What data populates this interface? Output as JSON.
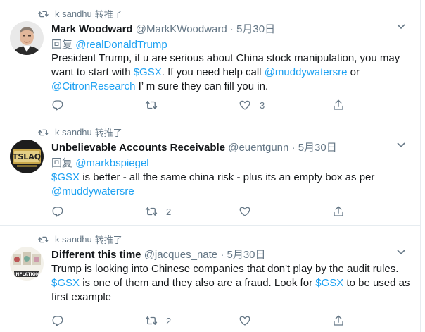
{
  "tweets": [
    {
      "retweeted_by": "k sandhu",
      "retweet_label": "转推了",
      "name": "Mark Woodward",
      "handle": "@MarkKWoodward",
      "dot": "·",
      "date": "5月30日",
      "reply_prefix": "回复",
      "reply_to": "@realDonaldTrump",
      "text": {
        "a": "President Trump, if u are serious about China stock manipulation, you may want to start with ",
        "link1": "$GSX",
        "b": ".  If you need help call ",
        "link2": "@muddywatersre",
        "c": "  or ",
        "link3": "@CitronResearch",
        "d": "   I’   m sure they can fill you in."
      },
      "actions": {
        "reply": "",
        "retweet": "",
        "like": "3"
      }
    },
    {
      "retweeted_by": "k sandhu",
      "retweet_label": "转推了",
      "name": "Unbelievable Accounts Receivable",
      "handle": "@euentgunn",
      "dot": "·",
      "date": "5月30日",
      "reply_prefix": "回复",
      "reply_to": "@markbspiegel",
      "text": {
        "link1": "$GSX",
        "a": " is better - all the same china risk - plus its an empty box as per ",
        "link2": "@muddywatersre"
      },
      "actions": {
        "reply": "",
        "retweet": "2",
        "like": ""
      }
    },
    {
      "retweeted_by": "k sandhu",
      "retweet_label": "转推了",
      "name": "Different this time",
      "handle": "@jacques_nate",
      "dot": "·",
      "date": "5月30日",
      "text": {
        "a": "Trump is looking into Chinese companies that don't play by the audit rules.  ",
        "link1": "$GSX",
        "b": " is one of them and they also are a fraud.  Look for ",
        "link2": "$GSX",
        "c": "  to be used as first example"
      },
      "actions": {
        "reply": "",
        "retweet": "2",
        "like": ""
      }
    }
  ],
  "avatars": {
    "t2_sign_text": "TSLAQ",
    "t3_badge_text": "INFLATION"
  },
  "colors": {
    "link": "#1da1f2",
    "muted": "#657786",
    "text": "#14171a",
    "divider": "#e6ecf0"
  },
  "icons": [
    "retweet-icon",
    "reply-icon",
    "like-icon",
    "share-icon",
    "caret-down-icon"
  ]
}
